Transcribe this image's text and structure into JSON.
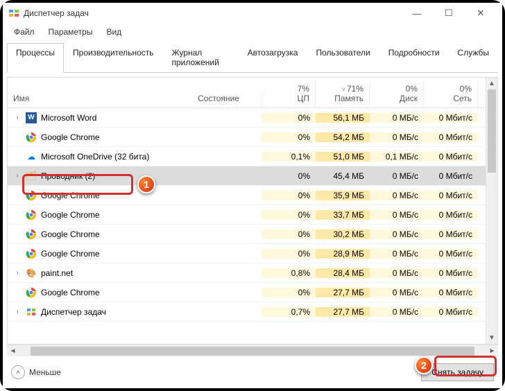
{
  "window": {
    "title": "Диспетчер задач",
    "controls": {
      "min": "—",
      "max": "☐",
      "close": "✕"
    }
  },
  "menu": {
    "file": "Файл",
    "options": "Параметры",
    "view": "Вид"
  },
  "tabs": {
    "processes": "Процессы",
    "performance": "Производительность",
    "apphistory": "Журнал приложений",
    "startup": "Автозагрузка",
    "users": "Пользователи",
    "details": "Подробности",
    "services": "Службы"
  },
  "columns": {
    "name": "Имя",
    "state": "Состояние",
    "cpu": {
      "pct": "7%",
      "label": "ЦП"
    },
    "mem": {
      "pct": "71%",
      "label": "Память",
      "sort": "˅"
    },
    "disk": {
      "pct": "0%",
      "label": "Диск"
    },
    "net": {
      "pct": "0%",
      "label": "Сеть"
    }
  },
  "rows": [
    {
      "exp": true,
      "icon": "word",
      "name": "Microsoft Word",
      "cpu": "0%",
      "mem": "56,1 МБ",
      "disk": "0 МБ/с",
      "net": "0 Мбит/с",
      "h": [
        "heat1",
        "heat2",
        "heat1",
        "heat1"
      ]
    },
    {
      "exp": false,
      "icon": "chrome",
      "name": "Google Chrome",
      "cpu": "0%",
      "mem": "54,2 МБ",
      "disk": "0 МБ/с",
      "net": "0 Мбит/с",
      "h": [
        "heat1",
        "heat2",
        "heat1",
        "heat1"
      ]
    },
    {
      "exp": false,
      "icon": "onedrive",
      "name": "Microsoft OneDrive (32 бита)",
      "cpu": "0,1%",
      "mem": "51,0 МБ",
      "disk": "0,1 МБ/с",
      "net": "0 Мбит/с",
      "h": [
        "heat1",
        "heat2",
        "heat1",
        "heat1"
      ]
    },
    {
      "exp": true,
      "icon": "explorer",
      "name": "Проводник (2)",
      "cpu": "0%",
      "mem": "45,4 МБ",
      "disk": "0 МБ/с",
      "net": "0 Мбит/с",
      "selected": true,
      "h": [
        "",
        "",
        "",
        ""
      ]
    },
    {
      "exp": false,
      "icon": "chrome",
      "name": "Google Chrome",
      "cpu": "0%",
      "mem": "35,9 МБ",
      "disk": "0 МБ/с",
      "net": "0 Мбит/с",
      "h": [
        "heat1",
        "heat2",
        "heat1",
        "heat1"
      ]
    },
    {
      "exp": false,
      "icon": "chrome",
      "name": "Google Chrome",
      "cpu": "0%",
      "mem": "33,7 МБ",
      "disk": "0 МБ/с",
      "net": "0 Мбит/с",
      "h": [
        "heat1",
        "heat2",
        "heat1",
        "heat1"
      ]
    },
    {
      "exp": false,
      "icon": "chrome",
      "name": "Google Chrome",
      "cpu": "0%",
      "mem": "30,2 МБ",
      "disk": "0 МБ/с",
      "net": "0 Мбит/с",
      "h": [
        "heat1",
        "heat2",
        "heat1",
        "heat1"
      ]
    },
    {
      "exp": false,
      "icon": "chrome",
      "name": "Google Chrome",
      "cpu": "0%",
      "mem": "28,9 МБ",
      "disk": "0 МБ/с",
      "net": "0 Мбит/с",
      "h": [
        "heat1",
        "heat2",
        "heat1",
        "heat1"
      ]
    },
    {
      "exp": true,
      "icon": "paint",
      "name": "paint.net",
      "cpu": "0,8%",
      "mem": "28,4 МБ",
      "disk": "0 МБ/с",
      "net": "0 Мбит/с",
      "h": [
        "heat1",
        "heat2",
        "heat1",
        "heat1"
      ]
    },
    {
      "exp": false,
      "icon": "chrome",
      "name": "Google Chrome",
      "cpu": "0%",
      "mem": "27,7 МБ",
      "disk": "0 МБ/с",
      "net": "0 Мбит/с",
      "h": [
        "heat1",
        "heat2",
        "heat1",
        "heat1"
      ]
    },
    {
      "exp": true,
      "icon": "tm",
      "name": "Диспетчер задач",
      "cpu": "0,7%",
      "mem": "27,7 МБ",
      "disk": "0 МБ/с",
      "net": "0 Мбит/с",
      "h": [
        "heat1",
        "heat2",
        "heat1",
        "heat1"
      ]
    }
  ],
  "footer": {
    "fewer": "Меньше",
    "endtask": "Снять задачу"
  },
  "callouts": {
    "one": "1",
    "two": "2"
  },
  "icons": {
    "word": "W",
    "chrome": "◉",
    "onedrive": "☁",
    "explorer": "📁",
    "paint": "▦",
    "tm": "▣"
  },
  "iconColors": {
    "word": {
      "bg": "#2b579a",
      "fg": "#fff"
    },
    "chrome": {
      "bg": "",
      "fg": ""
    },
    "explorer": {
      "bg": "#ffd866",
      "fg": "#333"
    }
  }
}
